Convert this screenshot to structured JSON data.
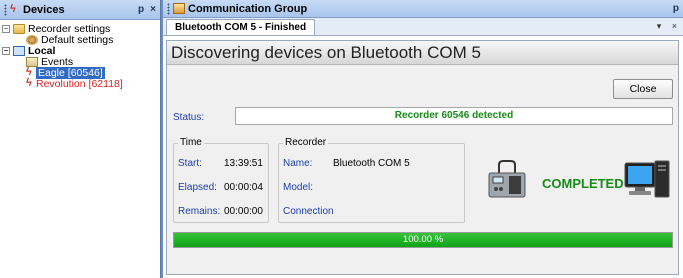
{
  "colors": {
    "accent_selected": "#316ac5",
    "status_green": "#188c1a",
    "progress_green": "#0ea315",
    "alert_red": "#e02020",
    "label_blue": "#1d3fa8"
  },
  "devices_pane": {
    "title": "Devices",
    "icon": "recorder-icon",
    "pin_label": "p",
    "close_label": "×",
    "tree": [
      {
        "label": "Recorder settings",
        "icon": "folder-settings-icon",
        "expander": "−"
      },
      {
        "label": "Default settings",
        "icon": "gear-icon"
      },
      {
        "label": "Local",
        "icon": "network-icon",
        "expander": "−"
      },
      {
        "label": "Events",
        "icon": "events-icon"
      },
      {
        "label": "Eagle [60546]",
        "icon": "recorder-icon",
        "selected": true
      },
      {
        "label": "Revolution [62118]",
        "icon": "recorder-icon"
      }
    ]
  },
  "comm_pane": {
    "title": "Communication Group",
    "pin_label": "p",
    "tab_label": "Bluetooth COM 5 - Finished",
    "tab_menu": "▾",
    "tab_close": "×"
  },
  "main": {
    "banner": "Discovering devices on Bluetooth COM 5",
    "close_button": "Close",
    "status_label": "Status:",
    "status_value": "Recorder 60546 detected",
    "time": {
      "title": "Time",
      "start_label": "Start:",
      "start_value": "13:39:51",
      "elapsed_label": "Elapsed:",
      "elapsed_value": "00:00:04",
      "remains_label": "Remains:",
      "remains_value": "00:00:00"
    },
    "recorder": {
      "title": "Recorder",
      "name_label": "Name:",
      "name_value": "Bluetooth COM 5",
      "model_label": "Model:",
      "connection_label": "Connection"
    },
    "completed_label": "COMPLETED",
    "progress": {
      "fraction": 1.0,
      "text": "100.00 %"
    }
  }
}
